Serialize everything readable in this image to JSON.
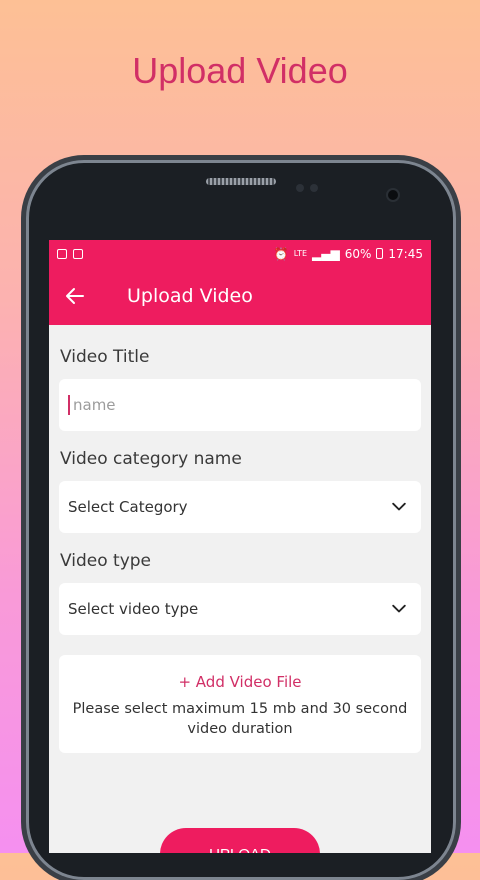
{
  "headline": "Upload Video",
  "status": {
    "battery": "60%",
    "time": "17:45",
    "network": "LTE"
  },
  "appbar": {
    "title": "Upload Video",
    "back_icon": "arrow-left-icon"
  },
  "form": {
    "title_label": "Video Title",
    "title_placeholder": "name",
    "category_label": "Video category name",
    "category_value": "Select Category",
    "type_label": "Video type",
    "type_value": "Select video type",
    "add_file": "+ Add Video File",
    "hint": "Please select maximum 15 mb and 30 second video duration",
    "upload_button": "UPLOAD"
  },
  "colors": {
    "accent": "#ee1c5f",
    "headline": "#d12f66"
  }
}
